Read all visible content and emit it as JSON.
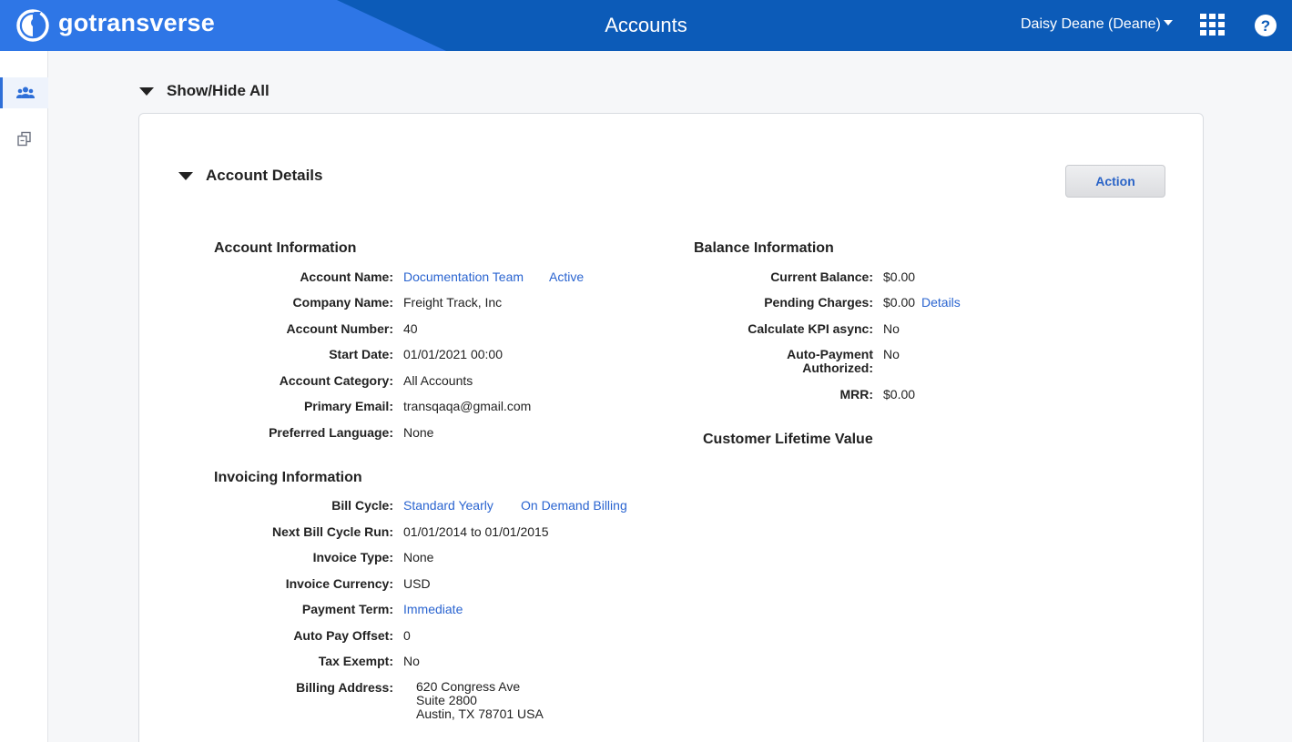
{
  "header": {
    "logo_text": "gotransverse",
    "title": "Accounts",
    "user_label": "Daisy Deane (Deane)"
  },
  "sidebar": {
    "items": [
      {
        "icon": "users-icon",
        "active": true
      },
      {
        "icon": "copy-icon",
        "active": false
      }
    ]
  },
  "main": {
    "show_hide_label": "Show/Hide All",
    "section_title": "Account Details",
    "action_label": "Action",
    "account_info": {
      "title": "Account Information",
      "account_name_label": "Account Name:",
      "account_name": "Documentation Team",
      "status": "Active",
      "company_name_label": "Company Name:",
      "company_name": "Freight Track, Inc",
      "account_number_label": "Account Number:",
      "account_number": "40",
      "start_date_label": "Start Date:",
      "start_date": "01/01/2021 00:00",
      "category_label": "Account Category:",
      "category": "All Accounts",
      "email_label": "Primary Email:",
      "email": "transqaqa@gmail.com",
      "language_label": "Preferred Language:",
      "language": "None"
    },
    "invoicing_info": {
      "title": "Invoicing Information",
      "bill_cycle_label": "Bill Cycle:",
      "bill_cycle": "Standard Yearly",
      "bill_cycle_extra": "On Demand Billing",
      "next_run_label": "Next Bill Cycle Run:",
      "next_run": "01/01/2014 to 01/01/2015",
      "invoice_type_label": "Invoice Type:",
      "invoice_type": "None",
      "currency_label": "Invoice Currency:",
      "currency": "USD",
      "payment_term_label": "Payment Term:",
      "payment_term": "Immediate",
      "auto_pay_label": "Auto Pay Offset:",
      "auto_pay": "0",
      "tax_exempt_label": "Tax Exempt:",
      "tax_exempt": "No",
      "billing_address_label": "Billing Address:",
      "address_line1": "620 Congress Ave",
      "address_line2": "Suite 2800",
      "address_line3": "Austin, TX 78701 USA"
    },
    "balance_info": {
      "title": "Balance Information",
      "current_balance_label": "Current Balance:",
      "current_balance": "$0.00",
      "pending_label": "Pending Charges:",
      "pending": "$0.00",
      "pending_link": "Details",
      "kpi_label": "Calculate KPI async:",
      "kpi": "No",
      "autopay_auth_label_1": "Auto-Payment",
      "autopay_auth_label_2": "Authorized:",
      "autopay_auth": "No",
      "mrr_label": "MRR:",
      "mrr": "$0.00"
    },
    "clv_title": "Customer Lifetime Value"
  },
  "colors": {
    "header_bg": "#0c5bb8",
    "brand_bg": "#2e76e6",
    "link": "#2a64d0"
  }
}
